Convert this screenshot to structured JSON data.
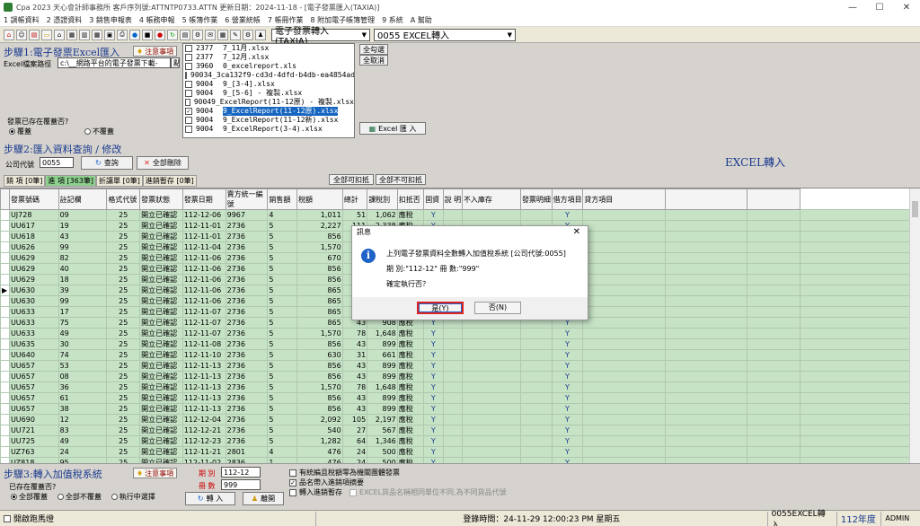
{
  "window": {
    "title": "Cpa 2023 天心會計師事務所 客戶序列號:ATTNTP0733.ATTN 更新日期：2024-11-18 - [電子發票匯入(TAXIA)]",
    "controls": [
      "—",
      "☐",
      "✕"
    ]
  },
  "menu": [
    "1 調帳資料",
    "2 憑證資料",
    "3 銷售申報表",
    "4 帳務申報",
    "5 帳簿作業",
    "6 營業統帳",
    "7 帳冊作業",
    "8 附加電子帳簿管理",
    "9 系統",
    "A 幫助"
  ],
  "toolbar": {
    "module_combo": "電子發票轉入(TAXIA)",
    "company_combo": "0055 EXCEL轉入"
  },
  "step1": {
    "title": "步驟1:電子發票Excel匯入",
    "note_label": "注意事項",
    "path_label": "Excel檔案路徑",
    "path_value": "c:\\__網路平台的電子發票下載-",
    "path_tail": "點",
    "overwrite_question": "發票已存在覆蓋否?",
    "overwrite_yes": "覆蓋",
    "overwrite_no": "不覆蓋",
    "select_all": "全勾選",
    "cancel_all": "全取消",
    "import_button": "Excel 匯 入",
    "files": [
      {
        "checked": false,
        "code": "2377",
        "name": "7_11月.xlsx",
        "selected": false
      },
      {
        "checked": false,
        "code": "2377",
        "name": "7_12月.xlsx",
        "selected": false
      },
      {
        "checked": false,
        "code": "3960",
        "name": "0_excelreport.xls",
        "selected": false
      },
      {
        "checked": false,
        "code": "9003",
        "name": "4_3ca132f9-cd3d-4dfd-b4db-ea4854ad0",
        "selected": false
      },
      {
        "checked": false,
        "code": "9004",
        "name": "9_[3-4].xlsx",
        "selected": false
      },
      {
        "checked": false,
        "code": "9004",
        "name": "9_[5-6] - 複製.xlsx",
        "selected": false
      },
      {
        "checked": false,
        "code": "9004",
        "name": "9_ExcelReport(11-12原) - 複製.xlsx",
        "selected": false
      },
      {
        "checked": true,
        "code": "9004",
        "name": "9_ExcelReport(11-12原).xlsx",
        "selected": true
      },
      {
        "checked": false,
        "code": "9004",
        "name": "9_ExcelReport(11-12新).xlsx",
        "selected": false
      },
      {
        "checked": false,
        "code": "9004",
        "name": "9_ExcelReport(3-4).xlsx",
        "selected": false
      }
    ]
  },
  "step2": {
    "title": "步驟2:匯入資料查詢 / 修改",
    "company_label": "公司代號",
    "company_value": "0055",
    "query_button": "查詢",
    "delete_all_button": "全部刪除",
    "heading": "EXCEL轉入",
    "all_deductible": "全部可扣抵",
    "all_nondeductible": "全部不可扣抵",
    "tabs": [
      "銷 項 [0筆]",
      "進 項 [363筆]",
      "折讓單 [0筆]",
      "進銷暫存 [0筆]"
    ],
    "columns": [
      "發票號碼",
      "註記欄",
      "格式代號",
      "發票狀態",
      "發票日期",
      "賣方統一編號",
      "銷售額",
      "稅額",
      "總計",
      "課稅別",
      "扣抵否",
      "固資",
      "說 明",
      "不入庫存",
      "發票明細",
      "借方項目",
      "貸方項目"
    ],
    "rows": [
      [
        "UJ728",
        "09",
        "25",
        "開立已確認",
        "112-12-06",
        "9967",
        "4",
        "1,011",
        "51",
        "1,062",
        "應稅",
        "Y",
        "Y"
      ],
      [
        "UU617",
        "19",
        "25",
        "開立已確認",
        "112-11-01",
        "2736",
        "5",
        "2,227",
        "111",
        "2,338",
        "應稅",
        "Y",
        "Y"
      ],
      [
        "UU618",
        "43",
        "25",
        "開立已確認",
        "112-11-01",
        "2736",
        "5",
        "856",
        "43",
        "899",
        "應稅",
        "Y",
        "Y"
      ],
      [
        "UU626",
        "99",
        "25",
        "開立已確認",
        "112-11-04",
        "2736",
        "5",
        "1,570",
        "78",
        "1,648",
        "應稅",
        "Y",
        "Y"
      ],
      [
        "UU629",
        "82",
        "25",
        "開立已確認",
        "112-11-06",
        "2736",
        "5",
        "670",
        "33",
        "703",
        "應稅",
        "Y",
        "Y"
      ],
      [
        "UU629",
        "40",
        "25",
        "開立已確認",
        "112-11-06",
        "2736",
        "5",
        "856",
        "43",
        "899",
        "應稅",
        "Y",
        "Y"
      ],
      [
        "UU629",
        "18",
        "25",
        "開立已確認",
        "112-11-06",
        "2736",
        "5",
        "856",
        "43",
        "899",
        "應稅",
        "Y",
        "Y"
      ],
      [
        "UU630",
        "39",
        "25",
        "開立已確認",
        "112-11-06",
        "2736",
        "5",
        "865",
        "43",
        "908",
        "應稅",
        "Y",
        "Y"
      ],
      [
        "UU630",
        "99",
        "25",
        "開立已確認",
        "112-11-06",
        "2736",
        "5",
        "865",
        "43",
        "908",
        "應稅",
        "Y",
        "Y"
      ],
      [
        "UU633",
        "17",
        "25",
        "開立已確認",
        "112-11-07",
        "2736",
        "5",
        "865",
        "43",
        "908",
        "應稅",
        "Y",
        "Y"
      ],
      [
        "UU633",
        "75",
        "25",
        "開立已確認",
        "112-11-07",
        "2736",
        "5",
        "865",
        "43",
        "908",
        "應稅",
        "Y",
        "Y"
      ],
      [
        "UU633",
        "49",
        "25",
        "開立已確認",
        "112-11-07",
        "2736",
        "5",
        "1,570",
        "78",
        "1,648",
        "應稅",
        "Y",
        "Y"
      ],
      [
        "UU635",
        "30",
        "25",
        "開立已確認",
        "112-11-08",
        "2736",
        "5",
        "856",
        "43",
        "899",
        "應稅",
        "Y",
        "Y"
      ],
      [
        "UU640",
        "74",
        "25",
        "開立已確認",
        "112-11-10",
        "2736",
        "5",
        "630",
        "31",
        "661",
        "應稅",
        "Y",
        "Y"
      ],
      [
        "UU657",
        "53",
        "25",
        "開立已確認",
        "112-11-13",
        "2736",
        "5",
        "856",
        "43",
        "899",
        "應稅",
        "Y",
        "Y"
      ],
      [
        "UU657",
        "08",
        "25",
        "開立已確認",
        "112-11-13",
        "2736",
        "5",
        "856",
        "43",
        "899",
        "應稅",
        "Y",
        "Y"
      ],
      [
        "UU657",
        "36",
        "25",
        "開立已確認",
        "112-11-13",
        "2736",
        "5",
        "1,570",
        "78",
        "1,648",
        "應稅",
        "Y",
        "Y"
      ],
      [
        "UU657",
        "61",
        "25",
        "開立已確認",
        "112-11-13",
        "2736",
        "5",
        "856",
        "43",
        "899",
        "應稅",
        "Y",
        "Y"
      ],
      [
        "UU657",
        "38",
        "25",
        "開立已確認",
        "112-11-13",
        "2736",
        "5",
        "856",
        "43",
        "899",
        "應稅",
        "Y",
        "Y"
      ],
      [
        "UU690",
        "12",
        "25",
        "開立已確認",
        "112-12-04",
        "2736",
        "5",
        "2,092",
        "105",
        "2,197",
        "應稅",
        "Y",
        "Y"
      ],
      [
        "UU721",
        "83",
        "25",
        "開立已確認",
        "112-12-21",
        "2736",
        "5",
        "540",
        "27",
        "567",
        "應稅",
        "Y",
        "Y"
      ],
      [
        "UU725",
        "49",
        "25",
        "開立已確認",
        "112-12-23",
        "2736",
        "5",
        "1,282",
        "64",
        "1,346",
        "應稅",
        "Y",
        "Y"
      ],
      [
        "UZ763",
        "24",
        "25",
        "開立已確認",
        "112-11-21",
        "2801",
        "4",
        "476",
        "24",
        "500",
        "應稅",
        "Y",
        "Y"
      ],
      [
        "UZ818",
        "95",
        "25",
        "開立已確認",
        "112-11-02",
        "2836",
        "1",
        "476",
        "24",
        "500",
        "應稅",
        "Y",
        "Y"
      ]
    ]
  },
  "dialog": {
    "title": "訊息",
    "line1": "上列電子發票資料全數轉入加值稅系統 [公司代號:0055]",
    "line2": "期 別:\"112-12\"  冊 數:\"999\"",
    "line3": "確定執行否？",
    "yes": "是(Y)",
    "no": "否(N)"
  },
  "step3": {
    "title": "步驟3:轉入加值稅系統",
    "note_label": "注意事項",
    "period_label": "期 別",
    "period_value": "112-12",
    "volume_label": "冊 數",
    "volume_value": "999",
    "transfer_button": "轉 入",
    "exit_button": "離開",
    "exists_question": "已存在覆蓋否?",
    "opt_all_overwrite": "全部覆蓋",
    "opt_no_overwrite": "全部不覆蓋",
    "opt_choose": "執行中選擇",
    "chk1": "有統編且稅額零為機關團體發票",
    "chk2": "品名帶入進銷項摘要",
    "chk3": "轉入進銷暫存",
    "chk4": "EXCEL貨品名稱相同單位不同,為不同貨品代號"
  },
  "status": {
    "left": "開啟跑馬燈",
    "login": "登錄時間：24-11-29 12:00:23 PM 星期五",
    "module": "0055EXCEL轉入",
    "year": "112年度",
    "user": "ADMIN"
  }
}
